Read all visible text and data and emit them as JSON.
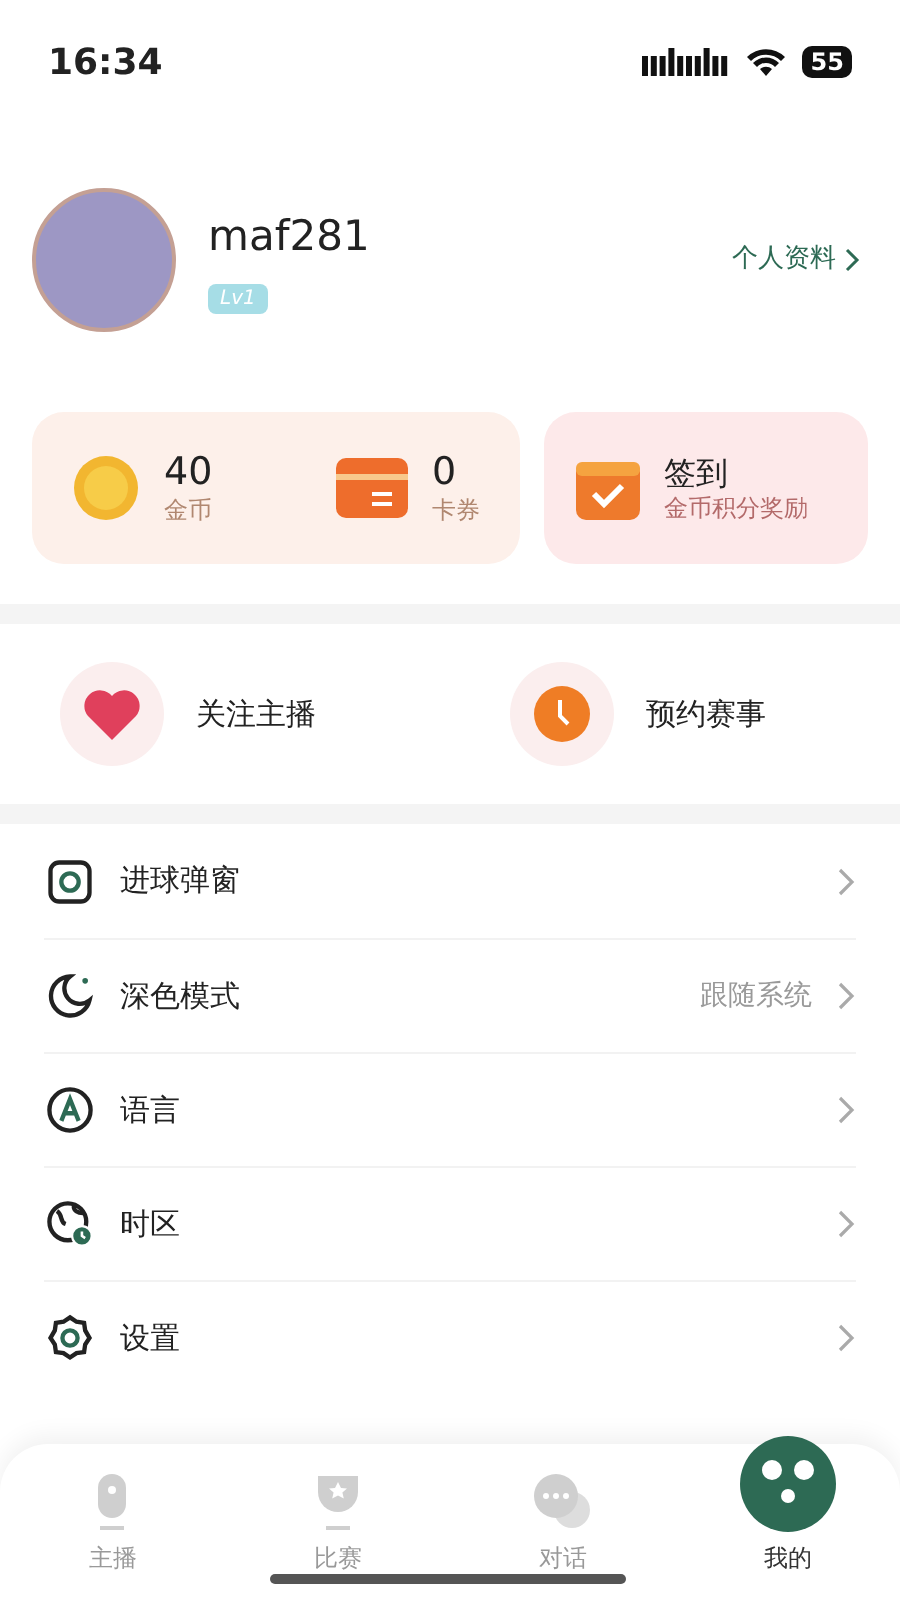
{
  "status_bar": {
    "time": "16:34",
    "battery": "55"
  },
  "profile": {
    "username": "maf281",
    "level_badge": "Lv1",
    "profile_link": "个人资料"
  },
  "wallet": [
    {
      "kind": "coin",
      "value": "40",
      "label": "金币"
    },
    {
      "kind": "card",
      "value": "0",
      "label": "卡券"
    }
  ],
  "checkin": {
    "title": "签到",
    "subtitle": "金币积分奖励"
  },
  "shortcuts": [
    {
      "kind": "heart",
      "label": "关注主播"
    },
    {
      "kind": "clock",
      "label": "预约赛事"
    }
  ],
  "menu": [
    {
      "kind": "popup",
      "label": "进球弹窗"
    },
    {
      "kind": "moon",
      "label": "深色模式",
      "value": "跟随系统"
    },
    {
      "kind": "language",
      "label": "语言"
    },
    {
      "kind": "timezone",
      "label": "时区"
    },
    {
      "kind": "settings",
      "label": "设置"
    }
  ],
  "tabs": [
    {
      "kind": "mic",
      "label": "主播",
      "selected": false
    },
    {
      "kind": "trophy",
      "label": "比赛",
      "selected": false
    },
    {
      "kind": "chat",
      "label": "对话",
      "selected": false
    },
    {
      "kind": "face",
      "label": "我的",
      "selected": true
    }
  ]
}
